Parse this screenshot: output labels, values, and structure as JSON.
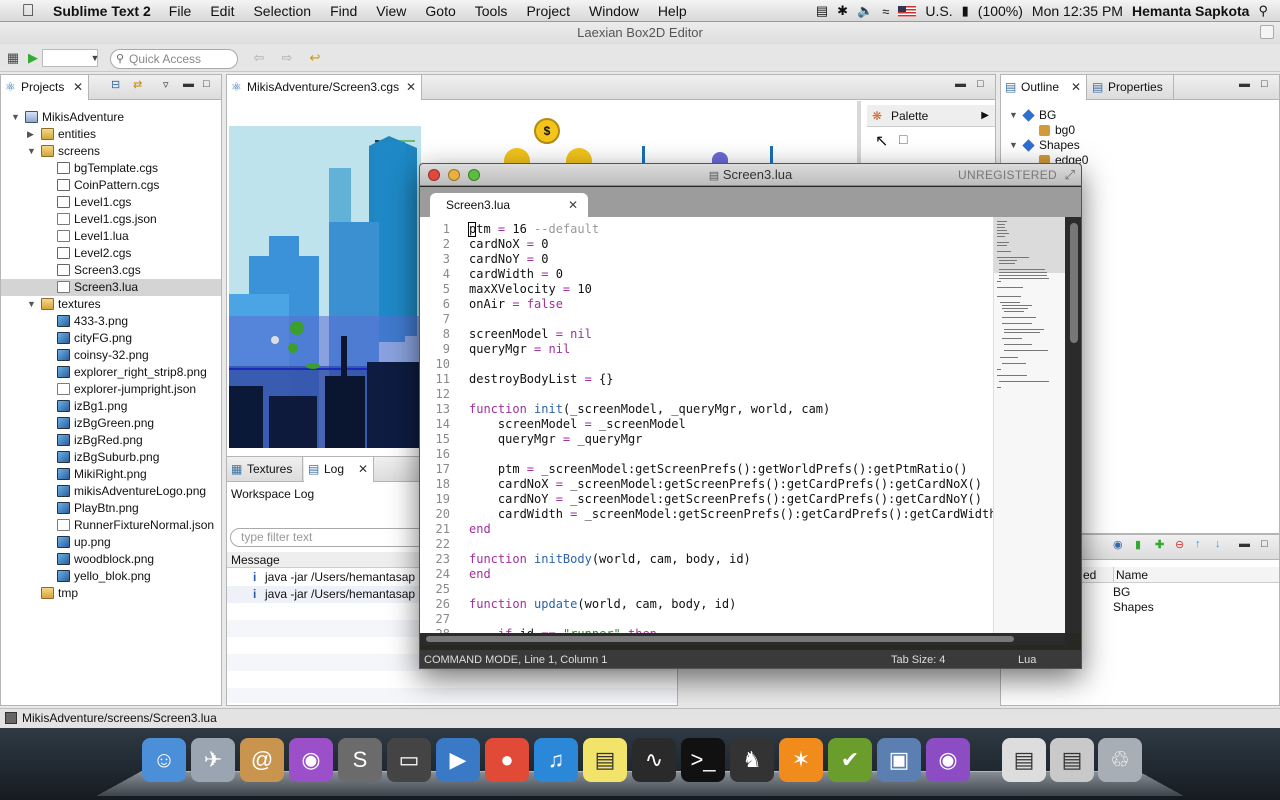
{
  "menubar": {
    "app": "Sublime Text 2",
    "items": [
      "File",
      "Edit",
      "Selection",
      "Find",
      "View",
      "Goto",
      "Tools",
      "Project",
      "Window",
      "Help"
    ],
    "input_source": "U.S.",
    "battery": "(100%)",
    "clock": "Mon 12:35 PM",
    "user": "Hemanta Sapkota"
  },
  "eclipse": {
    "title": "Laexian Box2D Editor",
    "quick_access_placeholder": "Quick Access",
    "projects_tab": "Projects",
    "editor_tab": "MikisAdventure/Screen3.cgs",
    "palette_label": "Palette",
    "outline_tab": "Outline",
    "properties_tab": "Properties",
    "textures_tab": "Textures",
    "log_tab": "Log",
    "workspace_log": "Workspace Log",
    "filter_placeholder": "type filter text",
    "message_header": "Message",
    "log_rows": [
      "java -jar /Users/hemantasap",
      "java -jar /Users/hemantasap"
    ],
    "status_path": "MikisAdventure/screens/Screen3.lua",
    "tree": [
      {
        "label": "MikisAdventure",
        "depth": 0,
        "type": "proj",
        "twisty": "open"
      },
      {
        "label": "entities",
        "depth": 1,
        "type": "folder",
        "twisty": "closed"
      },
      {
        "label": "screens",
        "depth": 1,
        "type": "folder",
        "twisty": "open"
      },
      {
        "label": "bgTemplate.cgs",
        "depth": 2,
        "type": "cgs"
      },
      {
        "label": "CoinPattern.cgs",
        "depth": 2,
        "type": "cgs"
      },
      {
        "label": "Level1.cgs",
        "depth": 2,
        "type": "cgs"
      },
      {
        "label": "Level1.cgs.json",
        "depth": 2,
        "type": "file"
      },
      {
        "label": "Level1.lua",
        "depth": 2,
        "type": "file"
      },
      {
        "label": "Level2.cgs",
        "depth": 2,
        "type": "cgs"
      },
      {
        "label": "Screen3.cgs",
        "depth": 2,
        "type": "cgs"
      },
      {
        "label": "Screen3.lua",
        "depth": 2,
        "type": "file",
        "selected": true
      },
      {
        "label": "textures",
        "depth": 1,
        "type": "folder",
        "twisty": "open"
      },
      {
        "label": "433-3.png",
        "depth": 2,
        "type": "img"
      },
      {
        "label": "cityFG.png",
        "depth": 2,
        "type": "img"
      },
      {
        "label": "coinsy-32.png",
        "depth": 2,
        "type": "img"
      },
      {
        "label": "explorer_right_strip8.png",
        "depth": 2,
        "type": "img"
      },
      {
        "label": "explorer-jumpright.json",
        "depth": 2,
        "type": "file"
      },
      {
        "label": "izBg1.png",
        "depth": 2,
        "type": "img"
      },
      {
        "label": "izBgGreen.png",
        "depth": 2,
        "type": "img"
      },
      {
        "label": "izBgRed.png",
        "depth": 2,
        "type": "img"
      },
      {
        "label": "izBgSuburb.png",
        "depth": 2,
        "type": "img"
      },
      {
        "label": "MikiRight.png",
        "depth": 2,
        "type": "img"
      },
      {
        "label": "mikisAdventureLogo.png",
        "depth": 2,
        "type": "img"
      },
      {
        "label": "PlayBtn.png",
        "depth": 2,
        "type": "img"
      },
      {
        "label": "RunnerFixtureNormal.json",
        "depth": 2,
        "type": "file"
      },
      {
        "label": "up.png",
        "depth": 2,
        "type": "img"
      },
      {
        "label": "woodblock.png",
        "depth": 2,
        "type": "img"
      },
      {
        "label": "yello_blok.png",
        "depth": 2,
        "type": "img"
      },
      {
        "label": "tmp",
        "depth": 1,
        "type": "folder"
      }
    ],
    "outline": [
      {
        "label": "BG",
        "depth": 0,
        "twisty": "open"
      },
      {
        "label": "bg0",
        "depth": 1
      },
      {
        "label": "Shapes",
        "depth": 0,
        "twisty": "open"
      },
      {
        "label": "edge0",
        "depth": 1
      }
    ],
    "props_header": [
      "ed",
      "Name"
    ],
    "props_rows": [
      "BG",
      "Shapes"
    ]
  },
  "sublime": {
    "title": "Screen3.lua",
    "unregistered": "UNREGISTERED",
    "tab": "Screen3.lua",
    "status_mode": "COMMAND MODE, Line 1, Column 1",
    "status_tab": "Tab Size: 4",
    "status_lang": "Lua",
    "lines": [
      "ptm = 16 --default",
      "cardNoX = 0",
      "cardNoY = 0",
      "cardWidth = 0",
      "maxXVelocity = 10",
      "onAir = false",
      "",
      "screenModel = nil",
      "queryMgr = nil",
      "",
      "destroyBodyList = {}",
      "",
      "function init(_screenModel, _queryMgr, world, cam)",
      "    screenModel = _screenModel",
      "    queryMgr = _queryMgr",
      "",
      "    ptm = _screenModel:getScreenPrefs():getWorldPrefs():getPtmRatio()",
      "    cardNoX = _screenModel:getScreenPrefs():getCardPrefs():getCardNoX()",
      "    cardNoY = _screenModel:getScreenPrefs():getCardPrefs():getCardNoY()",
      "    cardWidth = _screenModel:getScreenPrefs():getCardPrefs():getCardWidth()",
      "end",
      "",
      "function initBody(world, cam, body, id)",
      "end",
      "",
      "function update(world, cam, body, id)",
      "",
      "    if id == \"runner\" then"
    ]
  },
  "dock_apps": [
    "finder-icon",
    "launchpad-icon",
    "contacts-icon",
    "eclipse-icon",
    "sublime-icon",
    "terminal-window-icon",
    "facetime-icon",
    "chrome-icon",
    "itunes-icon",
    "stickies-icon",
    "activity-monitor-icon",
    "terminal-icon",
    "github-icon",
    "xampp-icon",
    "checkmark-icon",
    "preview-icon",
    "eclipse-icon-2",
    "documents-icon",
    "downloads-icon",
    "trash-icon"
  ]
}
